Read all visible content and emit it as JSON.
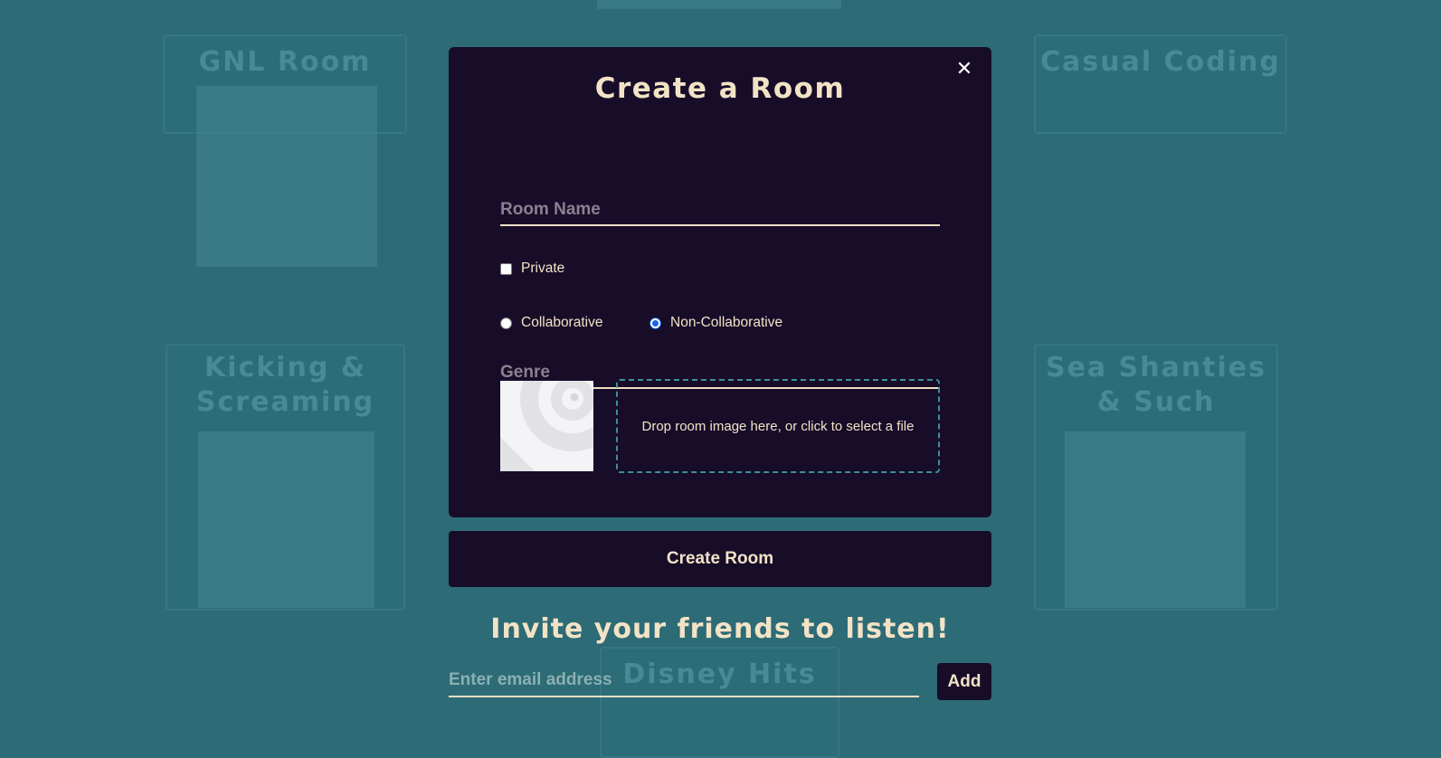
{
  "background": {
    "cards": [
      {
        "title": "GNL Room"
      },
      {
        "title": "Casual Coding"
      },
      {
        "title": "Kicking & Screaming"
      },
      {
        "title": "Sea Shanties & Such"
      },
      {
        "title": "Disney Hits"
      }
    ]
  },
  "modal": {
    "title": "Create a Room",
    "close_glyph": "✕",
    "room_name_placeholder": "Room Name",
    "private_label": "Private",
    "collaborative_label": "Collaborative",
    "non_collaborative_label": "Non-Collaborative",
    "selected_mode": "Non-Collaborative",
    "genre_placeholder": "Genre",
    "dropzone_text": "Drop room image here, or click to select a file"
  },
  "create_button_label": "Create Room",
  "invite": {
    "title": "Invite your friends to listen!",
    "email_placeholder": "Enter email address",
    "add_label": "Add"
  },
  "colors": {
    "background": "#2d6b76",
    "panel": "#170d29",
    "text": "#f3e3c6",
    "dropzone_border": "#3d8f98"
  },
  "icons": {
    "close": "close-icon",
    "thumbnail": "image-placeholder-icon"
  }
}
